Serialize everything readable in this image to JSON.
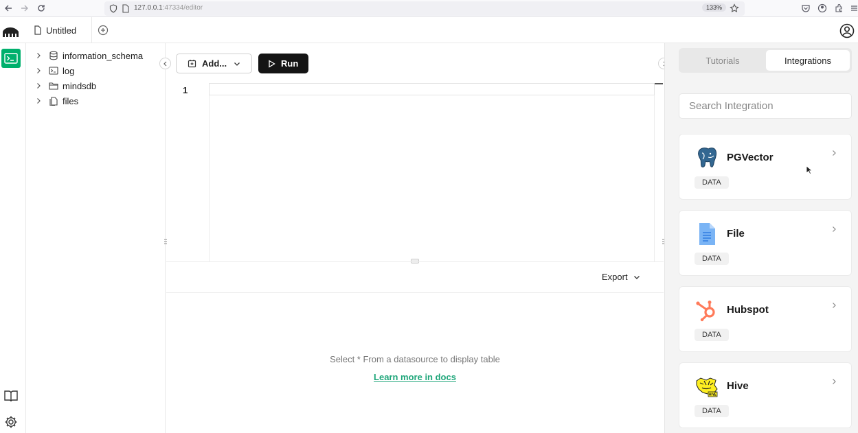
{
  "browser": {
    "url_host": "127.0.0.1",
    "url_rest": ":47334/editor",
    "zoom": "133%"
  },
  "app": {
    "tab_title": "Untitled"
  },
  "tree": {
    "items": [
      {
        "label": "information_schema",
        "icon": "database-icon"
      },
      {
        "label": "log",
        "icon": "terminal-icon"
      },
      {
        "label": "mindsdb",
        "icon": "folder-icon"
      },
      {
        "label": "files",
        "icon": "files-icon"
      }
    ]
  },
  "editor": {
    "add_label": "Add...",
    "run_label": "Run",
    "line_number": "1",
    "export_label": "Export",
    "empty_message": "Select * From a datasource to display table",
    "docs_link": "Learn more in docs"
  },
  "panel": {
    "tabs": [
      "Tutorials",
      "Integrations"
    ],
    "active_tab": "Integrations",
    "search_placeholder": "Search Integration",
    "integrations": [
      {
        "name": "PGVector",
        "badge": "DATA",
        "icon": "postgres-elephant-icon"
      },
      {
        "name": "File",
        "badge": "DATA",
        "icon": "document-icon"
      },
      {
        "name": "Hubspot",
        "badge": "DATA",
        "icon": "hubspot-icon"
      },
      {
        "name": "Hive",
        "badge": "DATA",
        "icon": "hive-bee-icon"
      }
    ]
  },
  "colors": {
    "accent": "#00b06d",
    "link": "#1fa67a",
    "run_bg": "#141414"
  }
}
